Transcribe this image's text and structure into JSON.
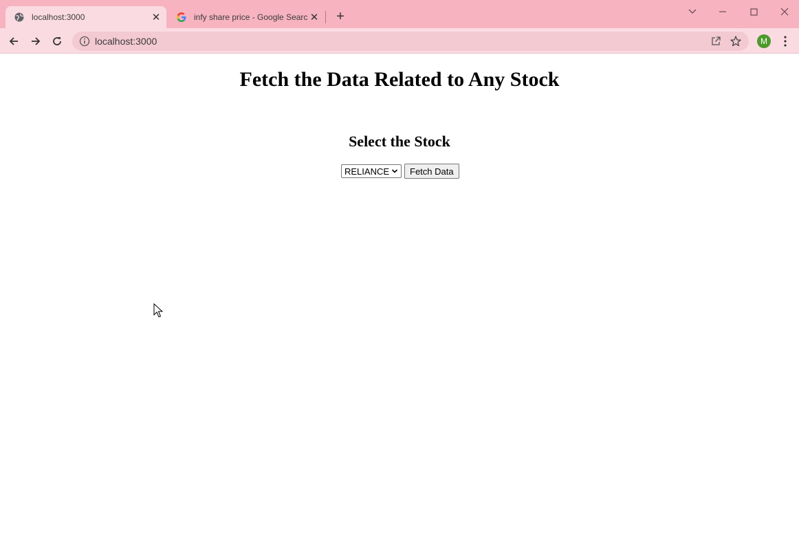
{
  "browser": {
    "tabs": [
      {
        "title": "localhost:3000",
        "active": true,
        "favicon": "globe-icon"
      },
      {
        "title": "infy share price - Google Search",
        "active": false,
        "favicon": "google-icon"
      }
    ],
    "new_tab_label": "+",
    "address": "localhost:3000",
    "profile_initial": "M",
    "colors": {
      "frame": "#f7b3c0",
      "toolbar": "#fbdbe2",
      "omnibox": "#f3c9d2",
      "avatar": "#4d9a2b"
    }
  },
  "page": {
    "title": "Fetch the Data Related to Any Stock",
    "subtitle": "Select the Stock",
    "stock_select": {
      "selected": "RELIANCE"
    },
    "fetch_button": "Fetch Data"
  }
}
